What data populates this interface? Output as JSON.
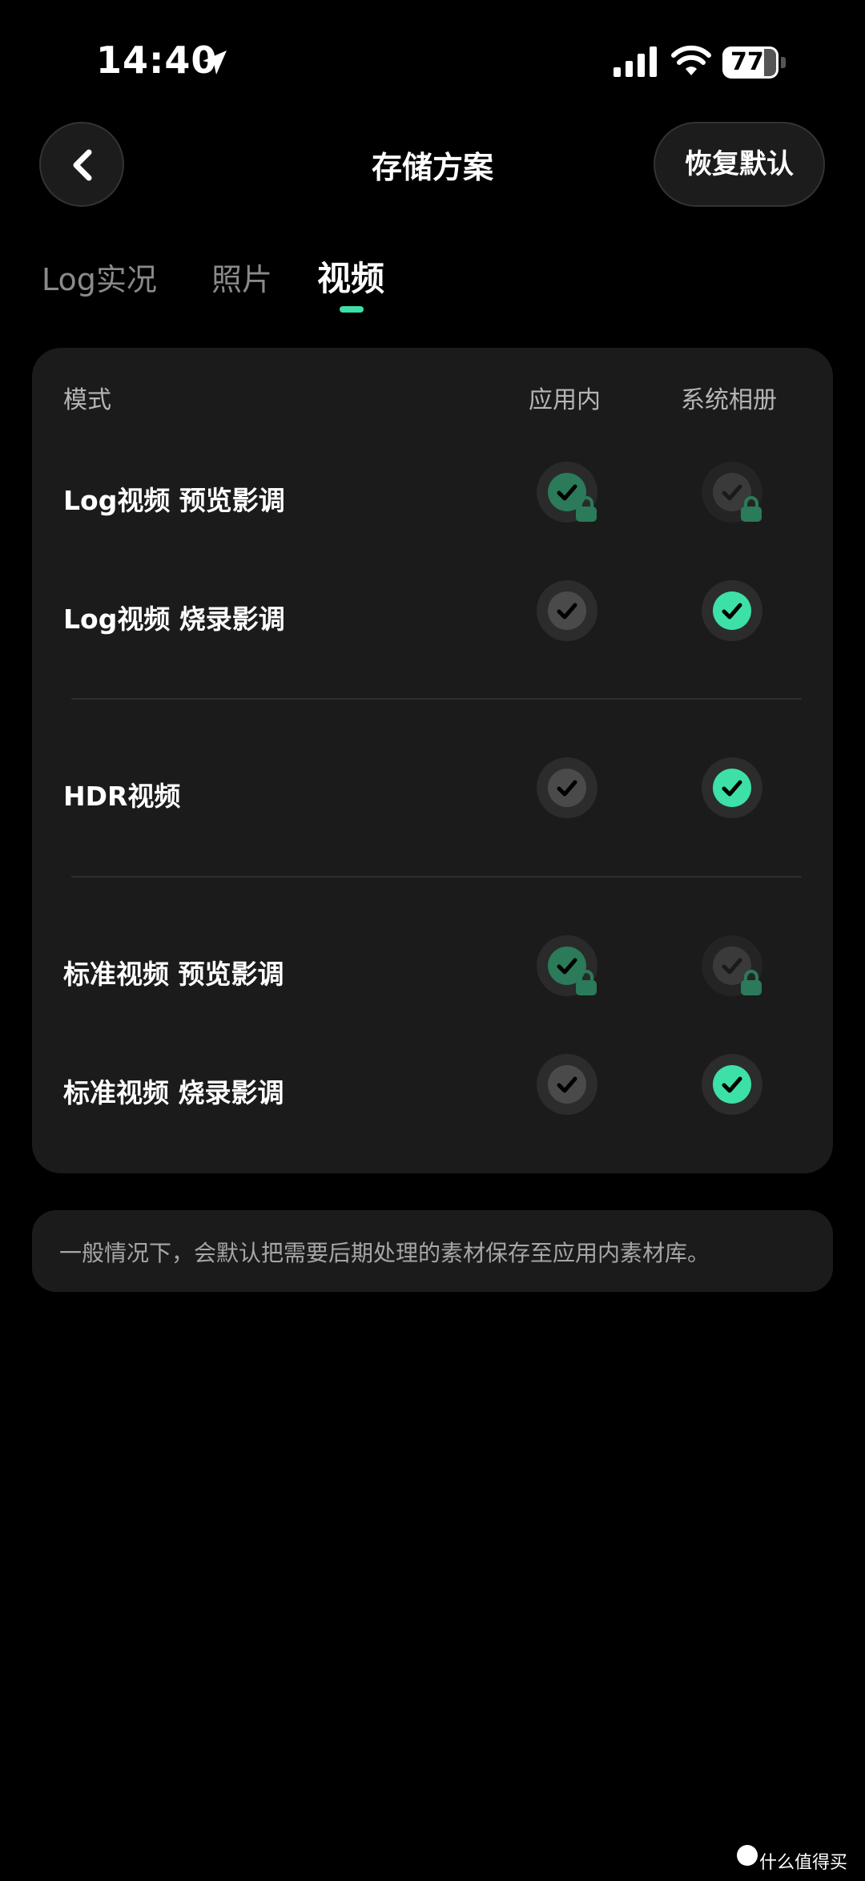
{
  "status_bar": {
    "time": "14:40",
    "battery": "77"
  },
  "header": {
    "title": "存储方案",
    "restore_label": "恢复默认"
  },
  "tabs": [
    {
      "label": "Log实况",
      "active": false
    },
    {
      "label": "照片",
      "active": false
    },
    {
      "label": "视频",
      "active": true
    }
  ],
  "table": {
    "columns": [
      "模式",
      "应用内",
      "系统相册"
    ],
    "rows": [
      {
        "label": "Log视频 预览影调",
        "in_app": "checked-locked",
        "album": "unchecked-locked"
      },
      {
        "label": "Log视频 烧录影调",
        "in_app": "unchecked",
        "album": "checked"
      },
      {
        "label": "HDR视频",
        "in_app": "unchecked",
        "album": "checked"
      },
      {
        "label": "标准视频 预览影调",
        "in_app": "checked-locked",
        "album": "unchecked-locked"
      },
      {
        "label": "标准视频 烧录影调",
        "in_app": "unchecked",
        "album": "checked"
      }
    ]
  },
  "note": "一般情况下，会默认把需要后期处理的素材保存至应用内素材库。",
  "watermark": "什么值得买",
  "colors": {
    "accent": "#3de0a6",
    "accent_dim": "#2b7a5a",
    "lock": "#2b7a5a",
    "card": "#1b1b1b",
    "background": "#000000"
  }
}
